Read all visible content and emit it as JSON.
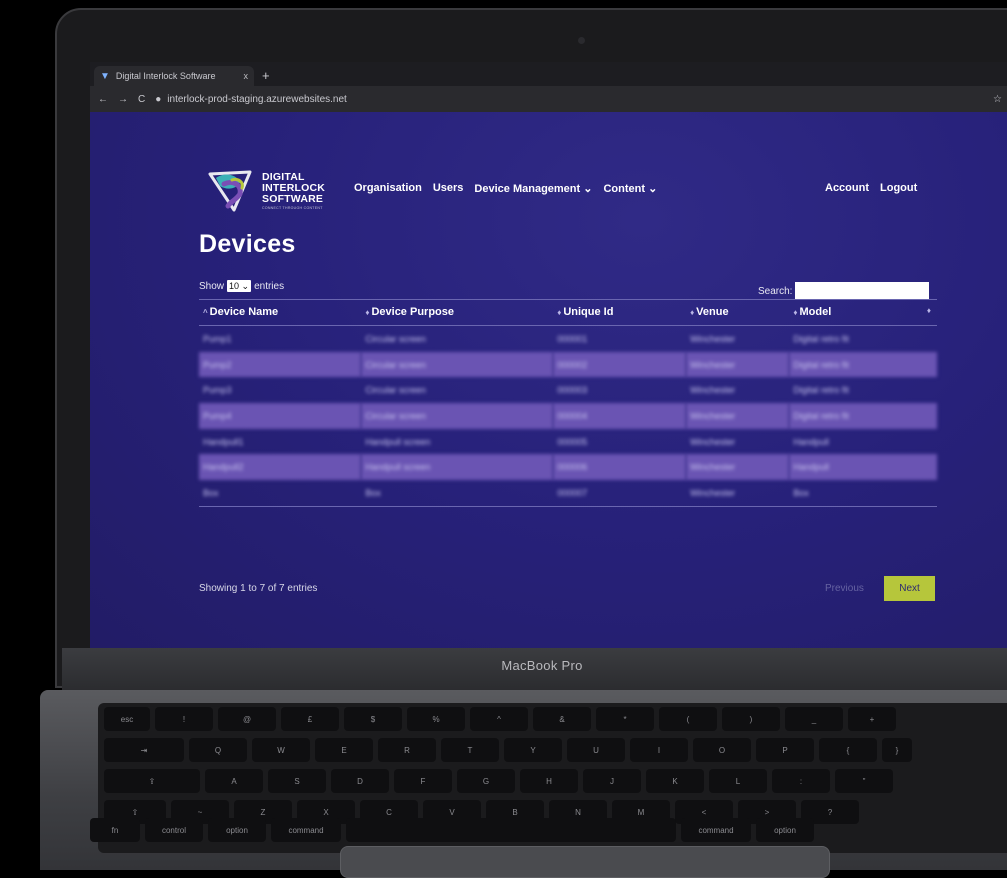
{
  "browser": {
    "tab_title": "Digital Interlock Software",
    "tab_close": "x",
    "new_tab": "+",
    "url": "interlock-prod-staging.azurewebsites.net",
    "nav_back": "←",
    "nav_forward": "→",
    "nav_reload": "C",
    "star": "☆"
  },
  "brand": {
    "line1": "DIGITAL",
    "line2": "INTERLOCK",
    "line3": "SOFTWARE",
    "tagline": "CONNECT THROUGH CONTENT",
    "colors": {
      "teal": "#3bb1b6",
      "purple": "#7a4fb5",
      "lime": "#b6c63b"
    }
  },
  "nav": {
    "items": [
      "Organisation",
      "Users",
      "Device Management ⌄",
      "Content ⌄"
    ],
    "right": [
      "Account",
      "Logout"
    ]
  },
  "page_title": "Devices",
  "length": {
    "show": "Show",
    "value": "10",
    "entries": "entries"
  },
  "search": {
    "label": "Search:"
  },
  "table": {
    "headers": [
      "Device Name",
      "Device Purpose",
      "Unique Id",
      "Venue",
      "Model"
    ],
    "sort_first": "^",
    "sort": "♦",
    "rows": [
      [
        "Pump1",
        "Circular screen",
        "000001",
        "Winchester",
        "Digital retro fit"
      ],
      [
        "Pump2",
        "Circular screen",
        "000002",
        "Winchester",
        "Digital retro fit"
      ],
      [
        "Pump3",
        "Circular screen",
        "000003",
        "Winchester",
        "Digital retro fit"
      ],
      [
        "Pump4",
        "Circular screen",
        "000004",
        "Winchester",
        "Digital retro fit"
      ],
      [
        "Handpull1",
        "Handpull screen",
        "000005",
        "Winchester",
        "Handpull"
      ],
      [
        "Handpull2",
        "Handpull screen",
        "000006",
        "Winchester",
        "Handpull"
      ],
      [
        "Box",
        "Box",
        "000007",
        "Winchester",
        "Box"
      ]
    ]
  },
  "footer": {
    "info": "Showing 1 to 7 of 7 entries",
    "previous": "Previous",
    "next": "Next"
  },
  "device": {
    "label": "MacBook Pro",
    "keys_row1": [
      "esc",
      "!",
      "@",
      "£",
      "$",
      "%",
      "^",
      "&",
      "*",
      "(",
      ")",
      "_",
      "+"
    ],
    "keys_row2": [
      "⇥",
      "Q",
      "W",
      "E",
      "R",
      "T",
      "Y",
      "U",
      "I",
      "O",
      "P",
      "{",
      "}"
    ],
    "keys_row3": [
      "⇪",
      "A",
      "S",
      "D",
      "F",
      "G",
      "H",
      "J",
      "K",
      "L",
      ":",
      "\""
    ],
    "keys_row4": [
      "⇧",
      "~",
      "Z",
      "X",
      "C",
      "V",
      "B",
      "N",
      "M",
      "<",
      ">",
      "?"
    ],
    "keys_row5": [
      "fn",
      "control",
      "option",
      "command",
      "command",
      "option"
    ]
  }
}
